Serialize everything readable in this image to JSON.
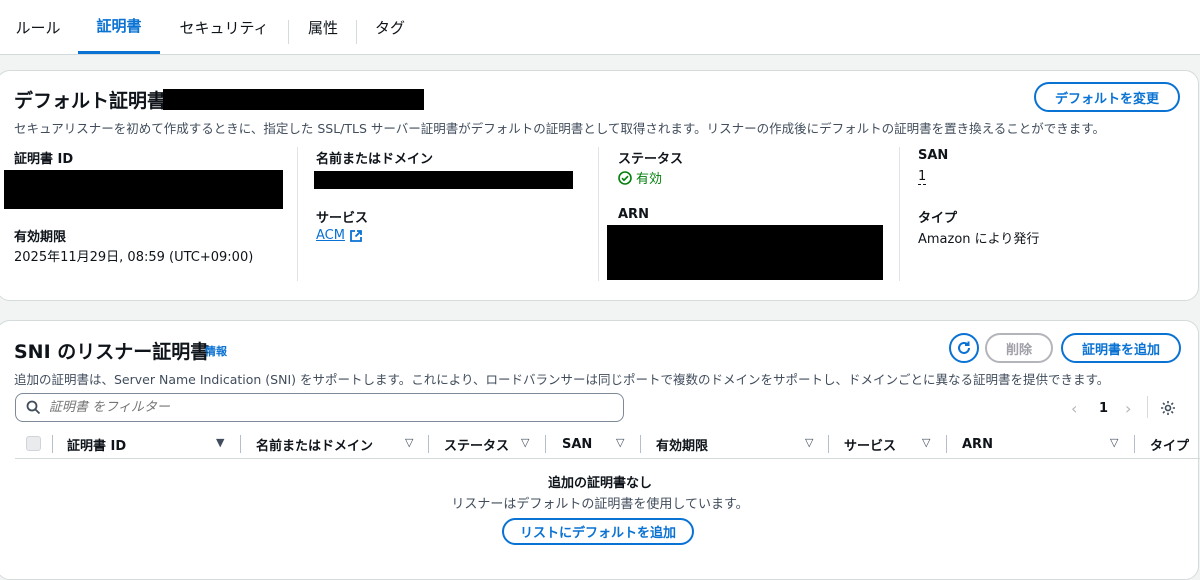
{
  "tabs": [
    "ルール",
    "証明書",
    "セキュリティ",
    "属性",
    "タグ"
  ],
  "default_cert": {
    "title": "デフォルト証明書",
    "description": "セキュアリスナーを初めて作成するときに、指定した SSL/TLS サーバー証明書がデフォルトの証明書として取得されます。リスナーの作成後にデフォルトの証明書を置き換えることができます。",
    "change_button": "デフォルトを変更",
    "cert_id_label": "証明書 ID",
    "expiry_label": "有効期限",
    "expiry_value": "2025年11月29日, 08:59 (UTC+09:00)",
    "name_domain_label": "名前またはドメイン",
    "service_label": "サービス",
    "service_value": "ACM",
    "status_label": "ステータス",
    "status_value": "有効",
    "arn_label": "ARN",
    "san_label": "SAN",
    "san_value": "1",
    "type_label": "タイプ",
    "type_value": "Amazon により発行"
  },
  "sni": {
    "title": "SNI のリスナー証明書",
    "info_link": "情報",
    "description": "追加の証明書は、Server Name Indication (SNI) をサポートします。これにより、ロードバランサーは同じポートで複数のドメインをサポートし、ドメインごとに異なる証明書を提供できます。",
    "delete_button": "削除",
    "add_button": "証明書を追加",
    "search_placeholder": "証明書 をフィルター",
    "page_number": "1",
    "columns": [
      "証明書 ID",
      "名前またはドメイン",
      "ステータス",
      "SAN",
      "有効期限",
      "サービス",
      "ARN",
      "タイプ"
    ],
    "empty_title": "追加の証明書なし",
    "empty_subtitle": "リスナーはデフォルトの証明書を使用しています。",
    "empty_button": "リストにデフォルトを追加"
  },
  "colors": {
    "accent": "#0972d3",
    "success": "#037f0c",
    "border": "#d5dbdb"
  }
}
